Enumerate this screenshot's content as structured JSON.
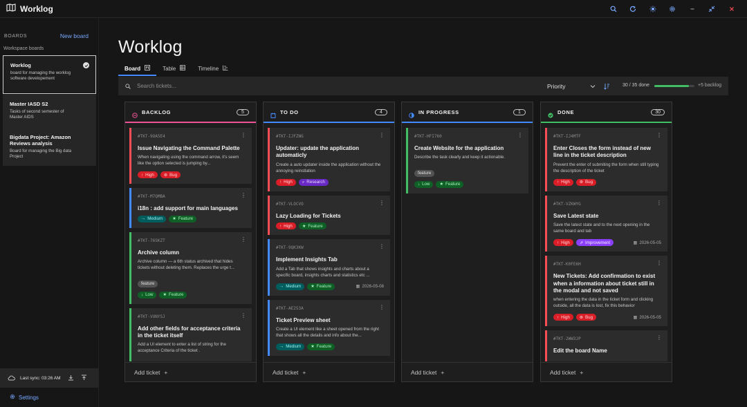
{
  "app": {
    "name": "Worklog"
  },
  "sidebar": {
    "title": "BOARDS",
    "new_board": "New board",
    "subtitle": "Workspace boards",
    "boards": [
      {
        "name": "Worklog",
        "desc": "board for managing the worklog software developement",
        "active": true
      },
      {
        "name": "Master IASD S2",
        "desc": "Tasks of second semester of Master AIDS",
        "active": false
      },
      {
        "name": "Bigdata Project: Amazon Reviews analysis",
        "desc": "Board for managing the Big data Project",
        "active": false
      }
    ],
    "sync_text": "Last sync: 03:26 AM",
    "settings": "Settings"
  },
  "main": {
    "title": "Worklog",
    "tabs": [
      {
        "label": "Board",
        "icon": "board-icon",
        "active": true
      },
      {
        "label": "Table",
        "icon": "table-icon",
        "active": false
      },
      {
        "label": "Timeline",
        "icon": "timeline-icon",
        "active": false
      }
    ],
    "search_placeholder": "Search tickets...",
    "sort_by": "Priority",
    "progress_text": "30 / 35 done",
    "progress_fraction": 0.857,
    "backlog_more": "+5 backlog"
  },
  "columns": [
    {
      "key": "backlog",
      "title": "BACKLOG",
      "count": "5",
      "color": "#ee5396",
      "icon": "backlog-icon",
      "add_label": "Add ticket",
      "cards": [
        {
          "id": "#TKT-9OA5E4",
          "title": "Issue Navigating the Command Palette",
          "desc": "When navigating using the command arrow, it's seem like the option selected is jumping by...",
          "priority": "High",
          "type": "Bug",
          "border": "#fa4d56"
        },
        {
          "id": "#TKT-M7QMBA",
          "title": "i18n : add support for main languages",
          "desc": "",
          "priority": "Medium",
          "type": "Feature",
          "border": "#4589ff"
        },
        {
          "id": "#TKT-76SKZT",
          "title": "Archive column",
          "desc": "Archive column — a 6th status archived that hides tickets without deleting them. Replaces the urge t...",
          "label": "feature",
          "priority": "Low",
          "type": "Feature",
          "border": "#42be65"
        },
        {
          "id": "#TKT-VUNYSJ",
          "title": "Add other fields for acceptance criteria in the ticket itself",
          "desc": "Add a UI element to enter a list of string for the acceptance Criteria of the ticket .",
          "priority": "",
          "type": "",
          "border": "#42be65"
        }
      ]
    },
    {
      "key": "todo",
      "title": "TO DO",
      "count": "4",
      "color": "#4589ff",
      "icon": "todo-icon",
      "add_label": "Add ticket",
      "cards": [
        {
          "id": "#TKT-IJFZNG",
          "title": "Updater: update the application automaticly",
          "desc": "Create a auto updater inside the application without the annoying reinstlation",
          "priority": "High",
          "type": "Research",
          "border": "#fa4d56"
        },
        {
          "id": "#TKT-VLOCVO",
          "title": "Lazy Loading for Tickets",
          "desc": "",
          "priority": "High",
          "type": "Feature",
          "border": "#fa4d56"
        },
        {
          "id": "#TKT-9QK3KW",
          "title": "Implement Insights Tab",
          "desc": "Add a Tab that shows insights and charts about a specific board, insights charts and statistics etc ...",
          "priority": "Medium",
          "type": "Feature",
          "due": "2026-05-08",
          "border": "#4589ff"
        },
        {
          "id": "#TKT-AE253A",
          "title": "Ticket Preview sheet",
          "desc": "Create a UI element like a sheet opened from the right that shows all the details and info about the...",
          "priority": "Medium",
          "type": "Feature",
          "border": "#4589ff"
        }
      ]
    },
    {
      "key": "inprogress",
      "title": "IN PROGRESS",
      "count": "1",
      "color": "#4589ff",
      "icon": "inprogress-icon",
      "add_label": "Add ticket",
      "cards": [
        {
          "id": "#TKT-HFI760",
          "title": "Create Website for the application",
          "desc": "Describe the task clearly and keep it actionable.",
          "label": "feature",
          "priority": "Low",
          "type": "Feature",
          "border": "#42be65"
        }
      ]
    },
    {
      "key": "done",
      "title": "DONE",
      "count": "30",
      "color": "#42be65",
      "icon": "done-icon",
      "add_label": "Add ticket",
      "cards": [
        {
          "id": "#TKT-IJ4MTF",
          "title": "Enter Closes the form instead of new line in the ticket description",
          "desc": "Prevent the enter of submiting the form when still typing the description of the ticket",
          "priority": "High",
          "type": "Bug",
          "border": "#fa4d56"
        },
        {
          "id": "#TKT-VZKWYG",
          "title": "Save Latest state",
          "desc": "Save the latest state and to the next opening in the same board and tab",
          "priority": "High",
          "type": "Improvement",
          "due": "2026-05-05",
          "border": "#fa4d56"
        },
        {
          "id": "#TKT-K0FE6H",
          "title": "New Tickets: Add confirmation to exist when a information about ticket still in the modal and not saved",
          "desc": "when entering the data in the ticket form and clicking outside, all the data is lost, fix this behavior",
          "priority": "High",
          "type": "Bug",
          "due": "2026-05-05",
          "border": "#fa4d56"
        },
        {
          "id": "#TKT-2WW3JP",
          "title": "Edit the board Name",
          "desc": "",
          "priority": "",
          "type": "",
          "border": "#fa4d56"
        }
      ]
    }
  ]
}
